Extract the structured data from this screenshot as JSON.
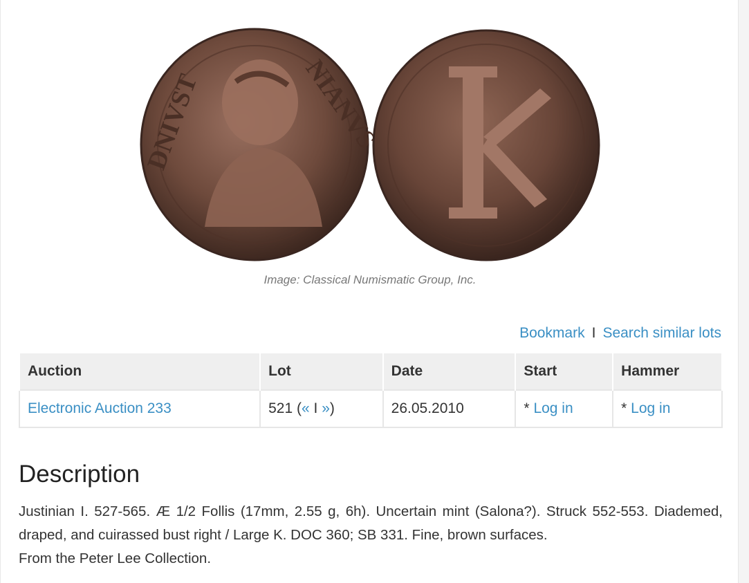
{
  "image": {
    "caption": "Image: Classical Numismatic Group, Inc.",
    "obverse_description": "Bronze coin obverse, diademed bust right",
    "reverse_description": "Bronze coin reverse, large K"
  },
  "actions": {
    "bookmark": "Bookmark",
    "separator": "I",
    "search_similar": "Search similar lots"
  },
  "table": {
    "headers": {
      "auction": "Auction",
      "lot": "Lot",
      "date": "Date",
      "start": "Start",
      "hammer": "Hammer"
    },
    "row": {
      "auction": "Electronic Auction 233",
      "lot_number": "521 (",
      "prev": "«",
      "lot_sep": " I ",
      "next": "»",
      "lot_close": ")",
      "date": "26.05.2010",
      "start_prefix": "* ",
      "start_link": "Log in",
      "hammer_prefix": "* ",
      "hammer_link": "Log in"
    }
  },
  "description": {
    "heading": "Description",
    "text": "Justinian I. 527-565. Æ 1/2 Follis (17mm, 2.55 g, 6h). Uncertain mint (Salona?). Struck 552-553. Diademed, draped, and cuirassed bust right / Large K. DOC 360; SB 331. Fine, brown surfaces.",
    "provenance": "From the Peter Lee Collection."
  },
  "colors": {
    "link": "#3a8fc4",
    "header_bg": "#efefef",
    "coin_bronze": "#7a5545"
  }
}
